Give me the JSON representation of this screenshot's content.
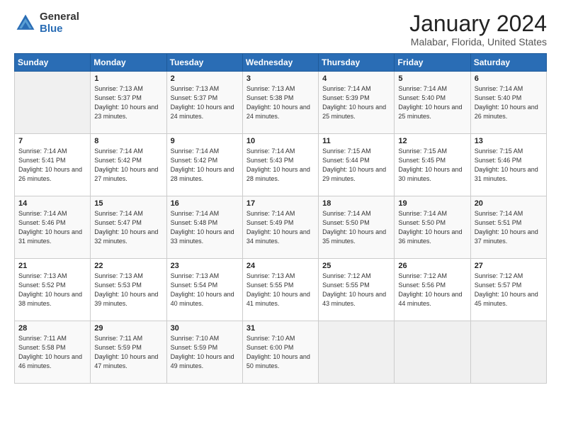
{
  "logo": {
    "general": "General",
    "blue": "Blue"
  },
  "header": {
    "month": "January 2024",
    "location": "Malabar, Florida, United States"
  },
  "days_of_week": [
    "Sunday",
    "Monday",
    "Tuesday",
    "Wednesday",
    "Thursday",
    "Friday",
    "Saturday"
  ],
  "weeks": [
    [
      {
        "num": "",
        "sunrise": "",
        "sunset": "",
        "daylight": ""
      },
      {
        "num": "1",
        "sunrise": "Sunrise: 7:13 AM",
        "sunset": "Sunset: 5:37 PM",
        "daylight": "Daylight: 10 hours and 23 minutes."
      },
      {
        "num": "2",
        "sunrise": "Sunrise: 7:13 AM",
        "sunset": "Sunset: 5:37 PM",
        "daylight": "Daylight: 10 hours and 24 minutes."
      },
      {
        "num": "3",
        "sunrise": "Sunrise: 7:13 AM",
        "sunset": "Sunset: 5:38 PM",
        "daylight": "Daylight: 10 hours and 24 minutes."
      },
      {
        "num": "4",
        "sunrise": "Sunrise: 7:14 AM",
        "sunset": "Sunset: 5:39 PM",
        "daylight": "Daylight: 10 hours and 25 minutes."
      },
      {
        "num": "5",
        "sunrise": "Sunrise: 7:14 AM",
        "sunset": "Sunset: 5:40 PM",
        "daylight": "Daylight: 10 hours and 25 minutes."
      },
      {
        "num": "6",
        "sunrise": "Sunrise: 7:14 AM",
        "sunset": "Sunset: 5:40 PM",
        "daylight": "Daylight: 10 hours and 26 minutes."
      }
    ],
    [
      {
        "num": "7",
        "sunrise": "Sunrise: 7:14 AM",
        "sunset": "Sunset: 5:41 PM",
        "daylight": "Daylight: 10 hours and 26 minutes."
      },
      {
        "num": "8",
        "sunrise": "Sunrise: 7:14 AM",
        "sunset": "Sunset: 5:42 PM",
        "daylight": "Daylight: 10 hours and 27 minutes."
      },
      {
        "num": "9",
        "sunrise": "Sunrise: 7:14 AM",
        "sunset": "Sunset: 5:42 PM",
        "daylight": "Daylight: 10 hours and 28 minutes."
      },
      {
        "num": "10",
        "sunrise": "Sunrise: 7:14 AM",
        "sunset": "Sunset: 5:43 PM",
        "daylight": "Daylight: 10 hours and 28 minutes."
      },
      {
        "num": "11",
        "sunrise": "Sunrise: 7:15 AM",
        "sunset": "Sunset: 5:44 PM",
        "daylight": "Daylight: 10 hours and 29 minutes."
      },
      {
        "num": "12",
        "sunrise": "Sunrise: 7:15 AM",
        "sunset": "Sunset: 5:45 PM",
        "daylight": "Daylight: 10 hours and 30 minutes."
      },
      {
        "num": "13",
        "sunrise": "Sunrise: 7:15 AM",
        "sunset": "Sunset: 5:46 PM",
        "daylight": "Daylight: 10 hours and 31 minutes."
      }
    ],
    [
      {
        "num": "14",
        "sunrise": "Sunrise: 7:14 AM",
        "sunset": "Sunset: 5:46 PM",
        "daylight": "Daylight: 10 hours and 31 minutes."
      },
      {
        "num": "15",
        "sunrise": "Sunrise: 7:14 AM",
        "sunset": "Sunset: 5:47 PM",
        "daylight": "Daylight: 10 hours and 32 minutes."
      },
      {
        "num": "16",
        "sunrise": "Sunrise: 7:14 AM",
        "sunset": "Sunset: 5:48 PM",
        "daylight": "Daylight: 10 hours and 33 minutes."
      },
      {
        "num": "17",
        "sunrise": "Sunrise: 7:14 AM",
        "sunset": "Sunset: 5:49 PM",
        "daylight": "Daylight: 10 hours and 34 minutes."
      },
      {
        "num": "18",
        "sunrise": "Sunrise: 7:14 AM",
        "sunset": "Sunset: 5:50 PM",
        "daylight": "Daylight: 10 hours and 35 minutes."
      },
      {
        "num": "19",
        "sunrise": "Sunrise: 7:14 AM",
        "sunset": "Sunset: 5:50 PM",
        "daylight": "Daylight: 10 hours and 36 minutes."
      },
      {
        "num": "20",
        "sunrise": "Sunrise: 7:14 AM",
        "sunset": "Sunset: 5:51 PM",
        "daylight": "Daylight: 10 hours and 37 minutes."
      }
    ],
    [
      {
        "num": "21",
        "sunrise": "Sunrise: 7:13 AM",
        "sunset": "Sunset: 5:52 PM",
        "daylight": "Daylight: 10 hours and 38 minutes."
      },
      {
        "num": "22",
        "sunrise": "Sunrise: 7:13 AM",
        "sunset": "Sunset: 5:53 PM",
        "daylight": "Daylight: 10 hours and 39 minutes."
      },
      {
        "num": "23",
        "sunrise": "Sunrise: 7:13 AM",
        "sunset": "Sunset: 5:54 PM",
        "daylight": "Daylight: 10 hours and 40 minutes."
      },
      {
        "num": "24",
        "sunrise": "Sunrise: 7:13 AM",
        "sunset": "Sunset: 5:55 PM",
        "daylight": "Daylight: 10 hours and 41 minutes."
      },
      {
        "num": "25",
        "sunrise": "Sunrise: 7:12 AM",
        "sunset": "Sunset: 5:55 PM",
        "daylight": "Daylight: 10 hours and 43 minutes."
      },
      {
        "num": "26",
        "sunrise": "Sunrise: 7:12 AM",
        "sunset": "Sunset: 5:56 PM",
        "daylight": "Daylight: 10 hours and 44 minutes."
      },
      {
        "num": "27",
        "sunrise": "Sunrise: 7:12 AM",
        "sunset": "Sunset: 5:57 PM",
        "daylight": "Daylight: 10 hours and 45 minutes."
      }
    ],
    [
      {
        "num": "28",
        "sunrise": "Sunrise: 7:11 AM",
        "sunset": "Sunset: 5:58 PM",
        "daylight": "Daylight: 10 hours and 46 minutes."
      },
      {
        "num": "29",
        "sunrise": "Sunrise: 7:11 AM",
        "sunset": "Sunset: 5:59 PM",
        "daylight": "Daylight: 10 hours and 47 minutes."
      },
      {
        "num": "30",
        "sunrise": "Sunrise: 7:10 AM",
        "sunset": "Sunset: 5:59 PM",
        "daylight": "Daylight: 10 hours and 49 minutes."
      },
      {
        "num": "31",
        "sunrise": "Sunrise: 7:10 AM",
        "sunset": "Sunset: 6:00 PM",
        "daylight": "Daylight: 10 hours and 50 minutes."
      },
      {
        "num": "",
        "sunrise": "",
        "sunset": "",
        "daylight": ""
      },
      {
        "num": "",
        "sunrise": "",
        "sunset": "",
        "daylight": ""
      },
      {
        "num": "",
        "sunrise": "",
        "sunset": "",
        "daylight": ""
      }
    ]
  ]
}
